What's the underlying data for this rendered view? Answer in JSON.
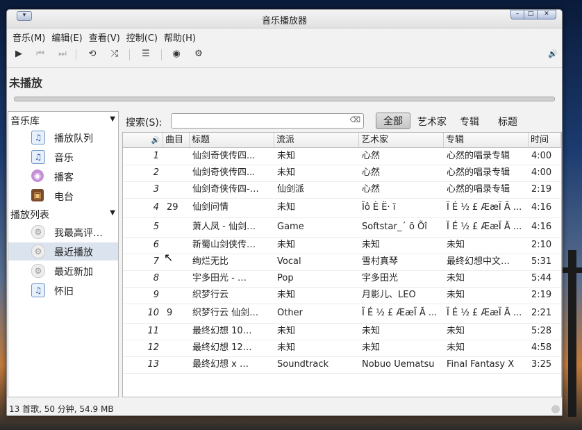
{
  "window": {
    "title": "音乐播放器"
  },
  "menu": [
    "音乐(M)",
    "编辑(E)",
    "查看(V)",
    "控制(C)",
    "帮助(H)"
  ],
  "toolbar": {
    "play": "▶",
    "prev": "⏮",
    "next": "⏭",
    "repeat": "⟲",
    "shuffle": "⤮",
    "playlist": "☰",
    "burn": "◉",
    "settings": "⚙",
    "volume": "🔊"
  },
  "now_playing": {
    "label": "未播放",
    "progress": 0
  },
  "sidebar": {
    "library_header": "音乐库",
    "library_items": [
      {
        "label": "播放队列",
        "icon": "note-icon"
      },
      {
        "label": "音乐",
        "icon": "note-icon"
      },
      {
        "label": "播客",
        "icon": "podcast-icon"
      },
      {
        "label": "电台",
        "icon": "radio-icon"
      }
    ],
    "playlist_header": "播放列表",
    "playlist_items": [
      {
        "label": "我最高评…",
        "icon": "gear-icon"
      },
      {
        "label": "最近播放",
        "icon": "gear-icon",
        "selected": true
      },
      {
        "label": "最近新加",
        "icon": "gear-icon"
      },
      {
        "label": "怀旧",
        "icon": "note-icon"
      }
    ]
  },
  "search": {
    "label": "搜索(S):",
    "value": ""
  },
  "filters": [
    "全部",
    "艺术家",
    "专辑",
    "标题"
  ],
  "table": {
    "columns": [
      "",
      "曲目",
      "标题",
      "流派",
      "艺术家",
      "专辑",
      "时间"
    ],
    "rows": [
      [
        "1",
        "",
        "仙剑奇侠传四...",
        "未知",
        "心然",
        "心然的唱录专辑",
        "4:00"
      ],
      [
        "2",
        "",
        "仙剑奇侠传四...",
        "未知",
        "心然",
        "心然的唱录专辑",
        "4:00"
      ],
      [
        "3",
        "",
        "仙剑奇侠传四-…",
        "仙剑派",
        "心然",
        "心然的唱录专辑",
        "2:19"
      ],
      [
        "4",
        "29",
        "仙剑问情",
        "未知",
        "Ïô È Ë· ï",
        "Ï É ½ £ ÆæÏ Ã ...",
        "4:16"
      ],
      [
        "5",
        "",
        "萧人凤 - 仙剑…",
        "Game",
        "Softstar_´ õ Õî",
        "Ï É ½ £ ÆæÏ Ã ...",
        "4:16"
      ],
      [
        "6",
        "",
        "新蜀山剑侠传…",
        "未知",
        "未知",
        "未知",
        "2:10"
      ],
      [
        "7",
        "",
        "绚烂无比",
        "Vocal",
        "雪村真琴",
        "最终幻想中文…",
        "5:31"
      ],
      [
        "8",
        "",
        "宇多田光 - …",
        "Pop",
        "宇多田光",
        "未知",
        "5:44"
      ],
      [
        "9",
        "",
        "织梦行云",
        "未知",
        "月影儿、LEO",
        "未知",
        "2:19"
      ],
      [
        "10",
        "9",
        "织梦行云 仙剑…",
        "Other",
        "Ï É ½ £ ÆæÏ Ã ...",
        "Ï É ½ £ ÆæÏ Ã ...",
        "2:21"
      ],
      [
        "11",
        "",
        "最终幻想 10…",
        "未知",
        "未知",
        "未知",
        "5:28"
      ],
      [
        "12",
        "",
        "最终幻想 12…",
        "未知",
        "未知",
        "未知",
        "4:58"
      ],
      [
        "13",
        "",
        "最终幻想 x …",
        "Soundtrack",
        "Nobuo Uematsu",
        "Final Fantasy X",
        "3:25"
      ]
    ]
  },
  "statusbar": {
    "text": "13 首歌, 50 分钟, 54.9 MB"
  }
}
